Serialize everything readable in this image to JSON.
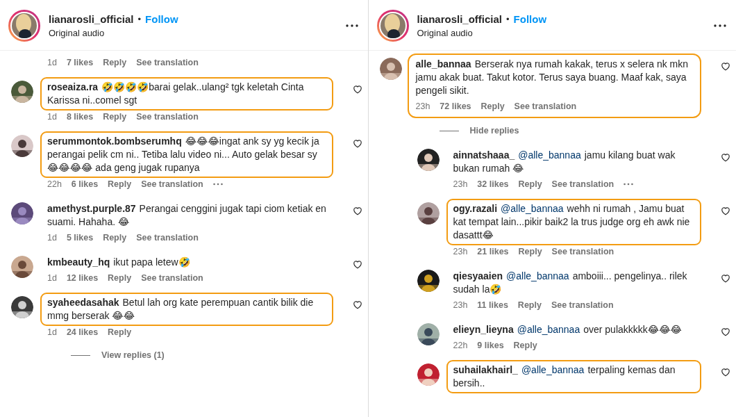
{
  "panels": [
    {
      "header": {
        "username": "lianarosli_official",
        "separator": "•",
        "follow": "Follow",
        "subtitle": "Original audio"
      },
      "comments": [
        {
          "kind": "meta_only",
          "time": "1d",
          "likes": "7 likes",
          "reply": "Reply",
          "translation": "See translation"
        },
        {
          "kind": "comment",
          "username": "roseaiza.ra",
          "text": "🤣🤣🤣🤣barai gelak..ulang² tgk keletah Cinta Karissa ni..comel sgt",
          "time": "1d",
          "likes": "8 likes",
          "reply": "Reply",
          "translation": "See translation",
          "more": false,
          "highlighted": true,
          "highlight_includes_meta": false
        },
        {
          "kind": "comment",
          "username": "serummontok.bombserumhq",
          "text": "😂😂😂ingat ank sy yg kecik ja perangai pelik cm ni.. Tetiba lalu video ni... Auto gelak besar sy 😂😂😂😂 ada geng jugak rupanya",
          "time": "22h",
          "likes": "6 likes",
          "reply": "Reply",
          "translation": "See translation",
          "more": true,
          "highlighted": true,
          "highlight_includes_meta": false
        },
        {
          "kind": "comment",
          "username": "amethyst.purple.87",
          "text": "Perangai cenggini jugak tapi ciom ketiak en suami. Hahaha. 😂",
          "time": "1d",
          "likes": "5 likes",
          "reply": "Reply",
          "translation": "See translation",
          "more": false,
          "highlighted": false
        },
        {
          "kind": "comment",
          "username": "kmbeauty_hq",
          "text": "ikut papa letew🤣",
          "time": "1d",
          "likes": "12 likes",
          "reply": "Reply",
          "translation": "See translation",
          "more": false,
          "highlighted": false
        },
        {
          "kind": "comment",
          "username": "syaheedasahak",
          "text": "Betul lah org kate perempuan cantik bilik die mmg berserak 😂😂",
          "time": "1d",
          "likes": "24 likes",
          "reply": "Reply",
          "more": false,
          "highlighted": true,
          "highlight_includes_meta": false,
          "replies_label": "View replies (1)"
        }
      ]
    },
    {
      "header": {
        "username": "lianarosli_official",
        "separator": "•",
        "follow": "Follow",
        "subtitle": "Original audio"
      },
      "comments": [
        {
          "kind": "comment",
          "username": "alle_bannaa",
          "text": "Berserak nya rumah kakak, terus x selera nk mkn jamu akak buat. Takut kotor. Terus saya buang. Maaf kak, saya pengeli sikit.",
          "time": "23h",
          "likes": "72 likes",
          "reply": "Reply",
          "translation": "See translation",
          "more": false,
          "highlighted": true,
          "highlight_includes_meta": true,
          "replies_label": "Hide replies",
          "children": [
            {
              "kind": "comment",
              "username": "ainnatshaaa_",
              "mention": "@alle_bannaa",
              "text": "jamu kilang buat wak bukan rumah 😂",
              "time": "23h",
              "likes": "32 likes",
              "reply": "Reply",
              "translation": "See translation",
              "more": true,
              "highlighted": false
            },
            {
              "kind": "comment",
              "username": "ogy.razali",
              "mention": "@alle_bannaa",
              "text": "wehh ni rumah , Jamu buat kat tempat lain...pikir baik2 la trus judge org eh awk nie dasattt😂",
              "time": "23h",
              "likes": "21 likes",
              "reply": "Reply",
              "translation": "See translation",
              "more": false,
              "highlighted": true,
              "highlight_includes_meta": false
            },
            {
              "kind": "comment",
              "username": "qiesyaaien",
              "mention": "@alle_bannaa",
              "text": "amboiii... pengelinya.. rilek sudah la🤣",
              "time": "23h",
              "likes": "11 likes",
              "reply": "Reply",
              "translation": "See translation",
              "more": false,
              "highlighted": false
            },
            {
              "kind": "comment",
              "username": "elieyn_lieyna",
              "mention": "@alle_bannaa",
              "text": "over pulakkkkk😂😂😂",
              "time": "22h",
              "likes": "9 likes",
              "reply": "Reply",
              "more": false,
              "highlighted": false
            },
            {
              "kind": "comment",
              "username": "suhailakhairl_",
              "mention": "@alle_bannaa",
              "text": "terpaling kemas dan bersih..",
              "more": false,
              "highlighted": true,
              "highlight_includes_meta": false
            }
          ]
        }
      ]
    }
  ]
}
